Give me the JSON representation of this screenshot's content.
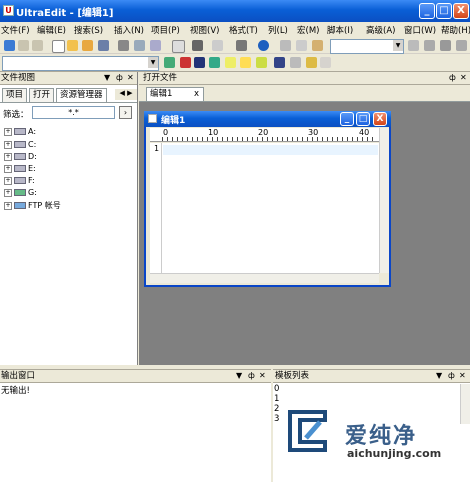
{
  "app": {
    "title": "UltraEdit - [编辑1]",
    "icon_letter": "U",
    "min_glyph": "_",
    "max_glyph": "□",
    "close_glyph": "X"
  },
  "menu": [
    "文件(F)",
    "编辑(E)",
    "搜索(S)",
    "插入(N)",
    "项目(P)",
    "视图(V)",
    "格式(T)",
    "列(L)",
    "宏(M)",
    "脚本(I)",
    "高级(A)",
    "窗口(W)",
    "帮助(H)"
  ],
  "file_view": {
    "title": "文件视图",
    "tabs": [
      "项目",
      "打开",
      "资源管理器"
    ],
    "filter_label": "筛选：",
    "filter_value": "*.*",
    "tree": [
      "A:",
      "C:",
      "D:",
      "E:",
      "F:",
      "G:",
      "FTP 帐号"
    ]
  },
  "open_files": {
    "title": "打开文件",
    "tab_label": "编辑1",
    "tab_close": "x"
  },
  "editor": {
    "title": "编辑1",
    "line_number": "1",
    "ruler_marks": [
      "0",
      "10",
      "20",
      "30",
      "40"
    ]
  },
  "output": {
    "title": "输出窗口",
    "text": "无输出!"
  },
  "template_list": {
    "title": "模板列表",
    "items": [
      "0",
      "1",
      "2",
      "3"
    ]
  },
  "panel_controls": {
    "dropdown": "▼",
    "pin": "ф",
    "close": "✕"
  },
  "watermark": {
    "brand": "爱纯净",
    "url": "aichunjing.com"
  },
  "colors": {
    "titlebar": "#0a5fd6",
    "workspace": "#808080",
    "window_bg": "#ece9d8",
    "watermark": "#3a5f8a"
  }
}
